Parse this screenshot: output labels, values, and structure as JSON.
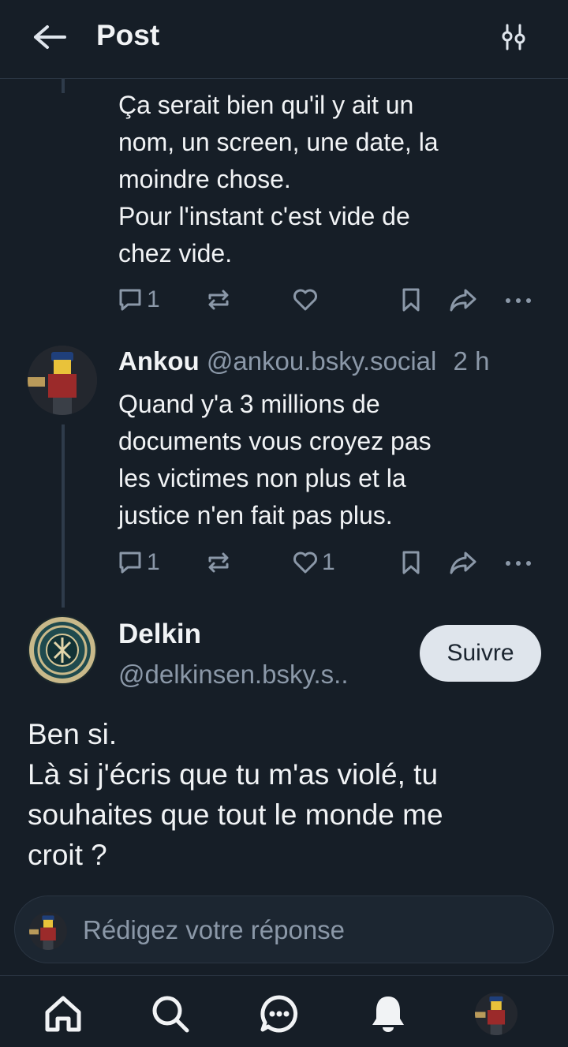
{
  "header": {
    "title": "Post"
  },
  "posts": [
    {
      "text_lines": [
        "Ça serait bien qu'il y ait un",
        "nom, un screen, une date, la",
        "moindre chose.",
        "Pour l'instant c'est vide de",
        "chez vide."
      ],
      "replies": "1",
      "reposts": "",
      "likes": ""
    },
    {
      "author_name": "Ankou",
      "author_handle": "@ankou.bsky.social",
      "time": "2 h",
      "text_lines": [
        "Quand y'a 3 millions de",
        "documents vous croyez pas",
        "les victimes non plus et la",
        "justice n'en fait pas plus."
      ],
      "replies": "1",
      "reposts": "",
      "likes": "1"
    }
  ],
  "main_post": {
    "author_name": "Delkin",
    "author_handle": "@delkinsen.bsky.s..",
    "follow_label": "Suivre",
    "text_lines": [
      "Ben si.",
      "Là si j'écris que tu m'as violé, tu",
      "souhaites que tout le monde me",
      "croit ?"
    ]
  },
  "reply": {
    "placeholder": "Rédigez votre réponse"
  },
  "nav": {
    "items": [
      "home-icon",
      "search-icon",
      "chat-icon",
      "bell-icon",
      "profile-avatar"
    ]
  },
  "colors": {
    "background": "#161e27",
    "muted": "#8b98a8",
    "text": "#f1f3f5",
    "button": "#dfe5ec"
  }
}
